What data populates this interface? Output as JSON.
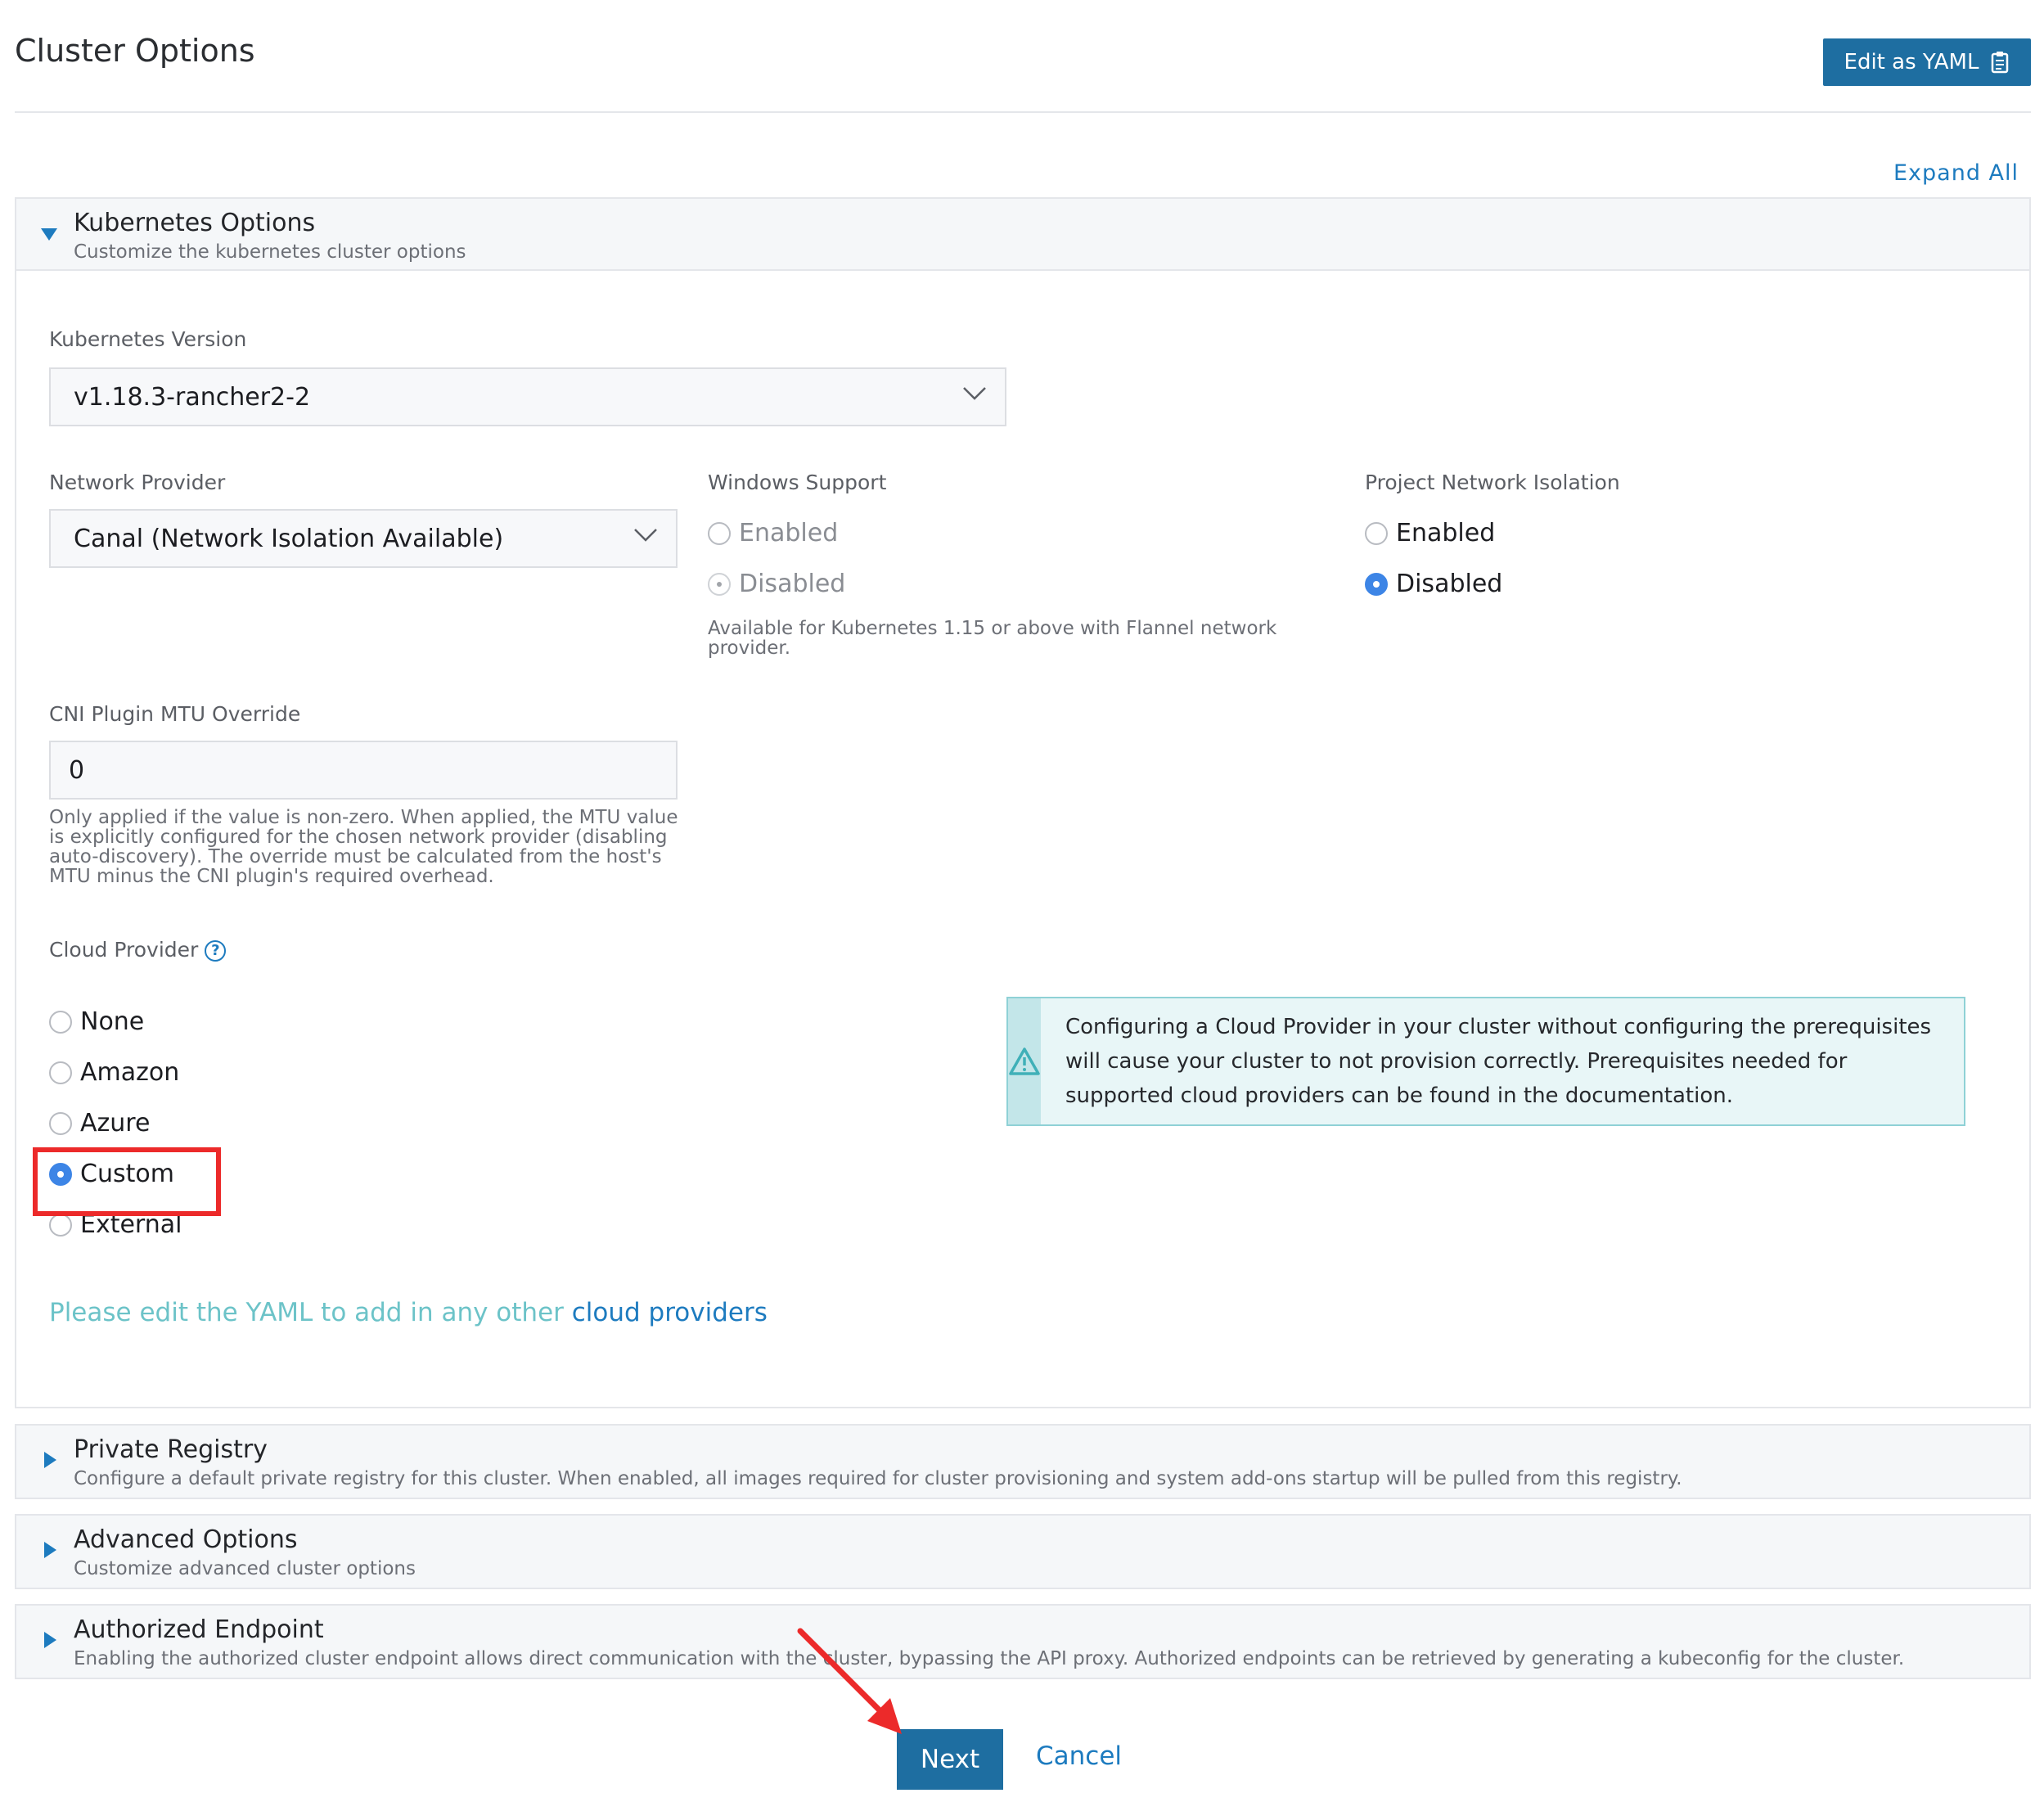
{
  "header": {
    "title": "Cluster Options",
    "yaml_button": "Edit as YAML",
    "expand_all": "Expand All"
  },
  "kubernetes_options": {
    "title": "Kubernetes Options",
    "subtitle": "Customize the kubernetes cluster options",
    "version_label": "Kubernetes Version",
    "version_value": "v1.18.3-rancher2-2",
    "network_provider_label": "Network Provider",
    "network_provider_value": "Canal (Network Isolation Available)",
    "windows_support": {
      "label": "Windows Support",
      "options": [
        "Enabled",
        "Disabled"
      ],
      "selected": "Disabled",
      "help": "Available for Kubernetes 1.15 or above with Flannel network provider."
    },
    "project_isolation": {
      "label": "Project Network Isolation",
      "options": [
        "Enabled",
        "Disabled"
      ],
      "selected": "Disabled"
    },
    "mtu": {
      "label": "CNI Plugin MTU Override",
      "value": "0",
      "help": "Only applied if the value is non-zero. When applied, the MTU value is explicitly configured for the chosen network provider (disabling auto-discovery). The override must be calculated from the host's MTU minus the CNI plugin's required overhead."
    },
    "cloud_provider": {
      "label": "Cloud Provider",
      "help_icon": "?",
      "options": [
        "None",
        "Amazon",
        "Azure",
        "Custom",
        "External"
      ],
      "selected": "Custom",
      "warning": "Configuring a Cloud Provider in your cluster without configuring the prerequisites will cause your cluster to not provision correctly. Prerequisites needed for supported cloud providers can be found in the documentation.",
      "yaml_hint": "Please edit the YAML to add in any other",
      "yaml_hint_link": "cloud providers"
    }
  },
  "collapsed_panels": [
    {
      "title": "Private Registry",
      "subtitle": "Configure a default private registry for this cluster. When enabled, all images required for cluster provisioning and system add-ons startup will be pulled from this registry."
    },
    {
      "title": "Advanced Options",
      "subtitle": "Customize advanced cluster options"
    },
    {
      "title": "Authorized Endpoint",
      "subtitle": "Enabling the authorized cluster endpoint allows direct communication with the cluster, bypassing the API proxy. Authorized endpoints can be retrieved by generating a kubeconfig for the cluster."
    }
  ],
  "footer": {
    "next": "Next",
    "cancel": "Cancel"
  },
  "colors": {
    "primary": "#1e6ea1",
    "link": "#1d7bbf",
    "radio_selected": "#3d85e6",
    "annotation_red": "#ec2a2a",
    "info_border": "#8fd1d6"
  },
  "icons": [
    "clipboard-icon",
    "caret-down-icon",
    "caret-right-icon",
    "chevron-down-icon",
    "help-icon",
    "warning-icon",
    "annotation-arrow-icon"
  ]
}
